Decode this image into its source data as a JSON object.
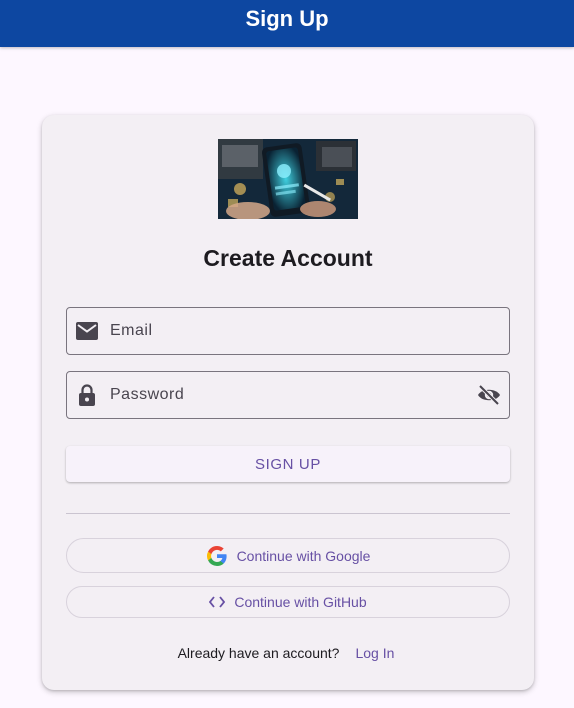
{
  "app_bar": {
    "title": "Sign Up"
  },
  "card": {
    "title": "Create Account",
    "hero_image": {
      "icon": "phone-illustration"
    },
    "email_field": {
      "placeholder": "Email",
      "value": "",
      "icon": "mail-icon"
    },
    "password_field": {
      "placeholder": "Password",
      "value": "",
      "icon": "lock-icon",
      "toggle_icon": "visibility-off-icon"
    },
    "signup_button": {
      "label": "SIGN UP"
    },
    "google_button": {
      "label": "Continue with Google",
      "icon": "google-icon"
    },
    "github_button": {
      "label": "Continue with GitHub",
      "icon": "code-icon"
    },
    "footer": {
      "text": "Already have an account?",
      "link_label": "Log In"
    }
  },
  "colors": {
    "app_bar": "#0d47a1",
    "background": "#fdf7ff",
    "card": "#f3eff4",
    "accent": "#6750a4",
    "outline": "#79747e"
  }
}
